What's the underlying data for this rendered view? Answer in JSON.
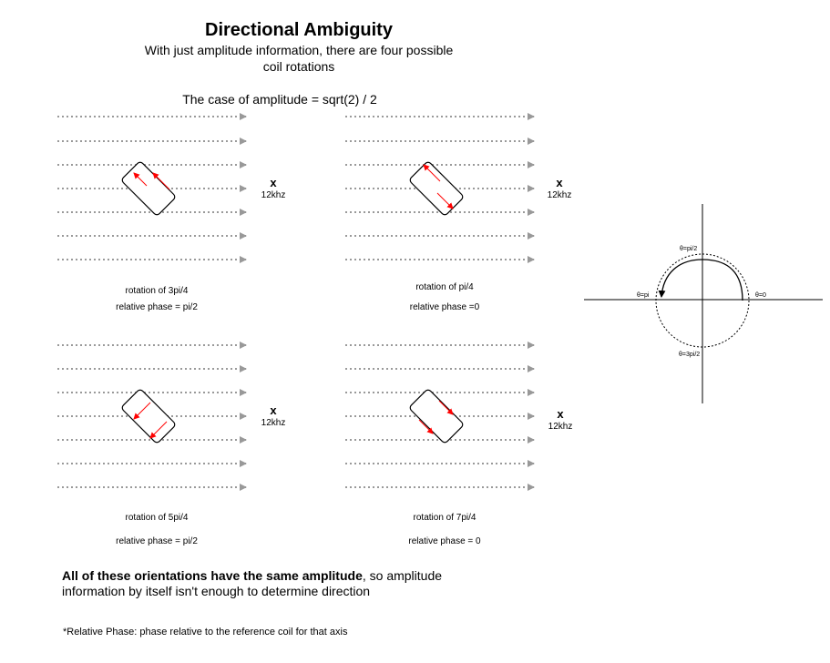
{
  "title": "Directional Ambiguity",
  "subtitle": "With just amplitude information, there are four possible coil rotations",
  "case_label": "The case of amplitude = sqrt(2) / 2",
  "panels": [
    {
      "rotation": "rotation of 3pi/4",
      "phase": "relative phase = pi/2",
      "x_label": "x",
      "freq": "12khz"
    },
    {
      "rotation": "rotation of pi/4",
      "phase": "relative phase =0",
      "x_label": "x",
      "freq": "12khz"
    },
    {
      "rotation": "rotation of 5pi/4",
      "phase": "relative phase = pi/2",
      "x_label": "x",
      "freq": "12khz"
    },
    {
      "rotation": "rotation of 7pi/4",
      "phase": "relative phase = 0",
      "x_label": "x",
      "freq": "12khz"
    }
  ],
  "angle_diagram": {
    "top": "θ=pi/2",
    "left": "θ=pi",
    "right": "θ=0",
    "bottom": "θ=3pi/2"
  },
  "conclusion_bold": "All of these orientations have the same amplitude",
  "conclusion_rest": ", so amplitude information by itself isn't enough to determine direction",
  "footnote": "*Relative Phase: phase relative to the reference coil for that axis",
  "colors": {
    "arrow": "#ff0000",
    "field_line": "#999999",
    "outline": "#000000"
  }
}
